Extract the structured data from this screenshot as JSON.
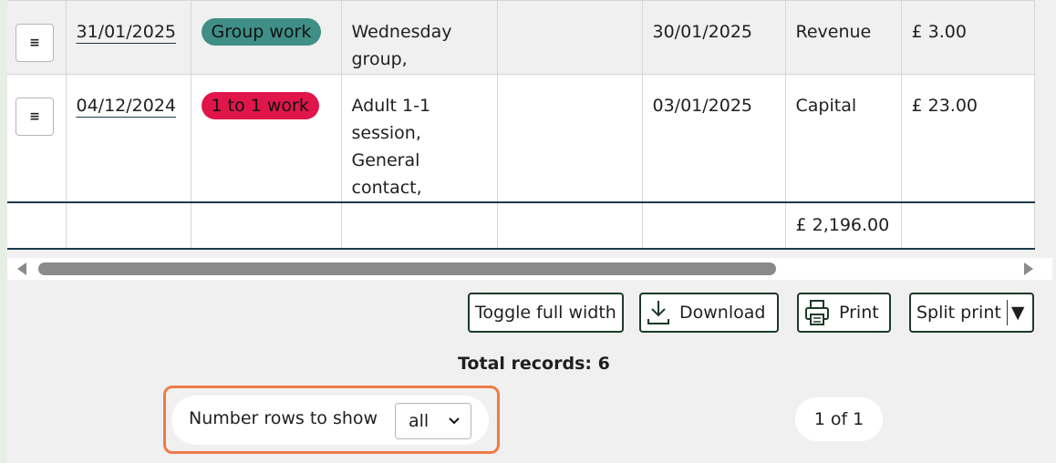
{
  "table": {
    "rows": [
      {
        "menu_icon": "≡",
        "date": "31/01/2025",
        "tag": "Group work",
        "tag_color": "#3f8f87",
        "description": "Wednesday group,",
        "empty": "",
        "date2": "30/01/2025",
        "type": "Revenue",
        "amount": "£ 3.00"
      },
      {
        "menu_icon": "≡",
        "date": "04/12/2024",
        "tag": "1 to 1 work",
        "tag_color": "#e0164a",
        "description": "Adult 1-1 session, General contact,",
        "empty": "",
        "date2": "03/01/2025",
        "type": "Capital",
        "amount": "£ 23.00"
      }
    ],
    "totals_row": {
      "total": "£ 2,196.00"
    }
  },
  "toolbar": {
    "toggle_label": "Toggle full width",
    "download_label": "Download",
    "print_label": "Print",
    "split_print_label": "Split print",
    "split_caret": "▼"
  },
  "summary": {
    "total_records": "Total records: 6"
  },
  "paging": {
    "rows_label": "Number rows to show",
    "rows_value": "all",
    "page_indicator": "1 of 1"
  },
  "colors": {
    "highlight": "#ee7b47",
    "border_dark": "#1c3a4a"
  }
}
